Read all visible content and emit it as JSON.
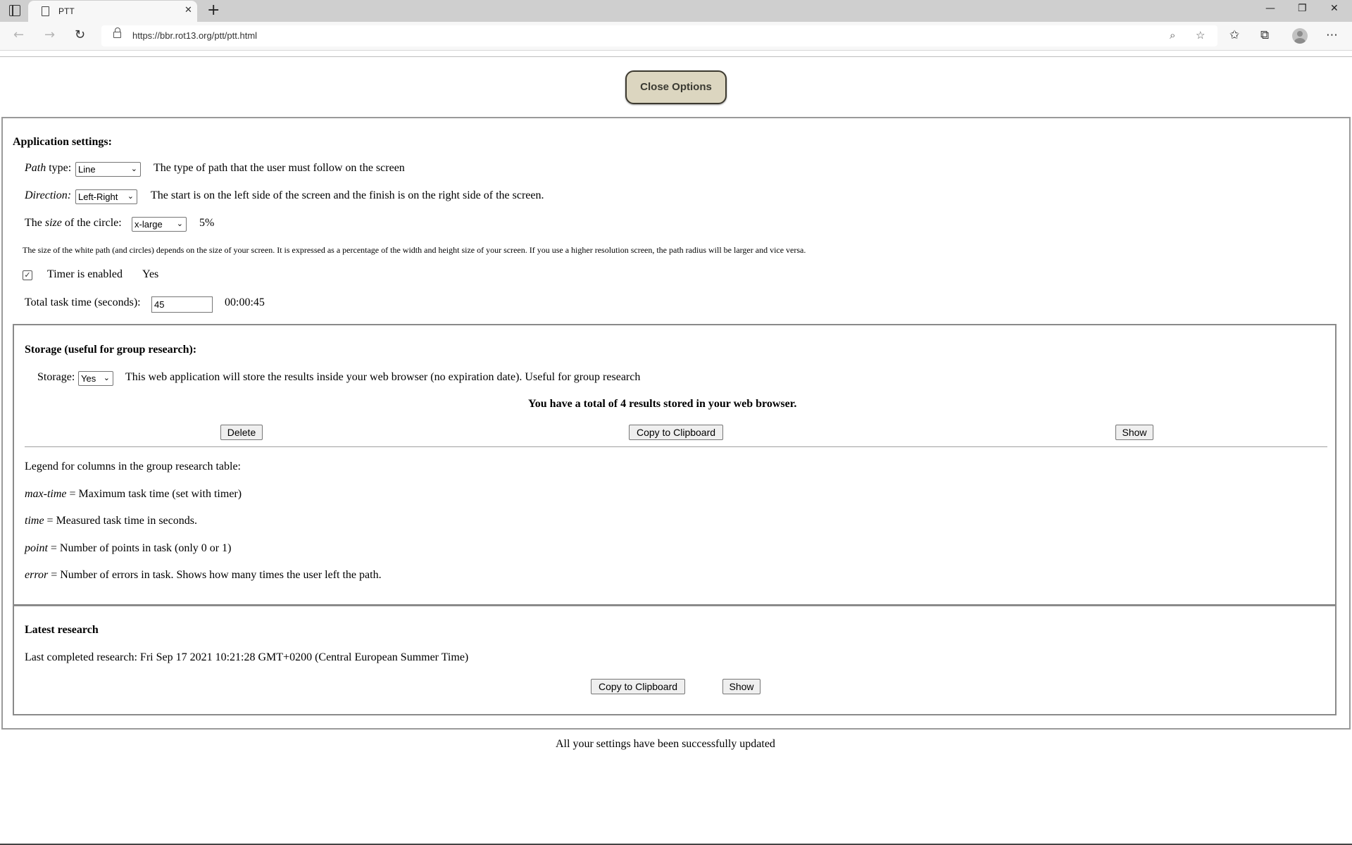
{
  "browser": {
    "tab_title": "PTT",
    "url": "https://bbr.rot13.org/ptt/ptt.html",
    "icons": [
      "sidebar-icon",
      "page-icon",
      "close-icon",
      "new-tab-icon",
      "back-icon",
      "forward-icon",
      "refresh-icon",
      "lock-icon",
      "zoom-icon",
      "add-favorite-icon",
      "favorites-icon",
      "collections-icon",
      "profile-icon",
      "more-icon",
      "minimize-icon",
      "restore-icon",
      "window-close-icon"
    ]
  },
  "close_options_label": "Close Options",
  "app_settings": {
    "heading": "Application settings:",
    "path_type": {
      "label_italic": "Path",
      "label_rest": " type:",
      "value": "Line",
      "description": "The type of path that the user must follow on the screen"
    },
    "direction": {
      "label": "Direction:",
      "value": "Left-Right",
      "description": "The start is on the left side of the screen and the finish is on the right side of the screen."
    },
    "size": {
      "label_before": "The ",
      "label_italic": "size",
      "label_after": " of the circle:",
      "value": "x-large",
      "percent": "5%"
    },
    "size_note": "The size of the white path (and circles) depends on the size of your screen. It is expressed as a percentage of the width and height size of your screen. If you use a higher resolution screen, the path radius will be larger and vice versa.",
    "timer": {
      "checked": true,
      "label": "Timer is enabled",
      "status": "Yes"
    },
    "total_time": {
      "label": "Total task time (seconds):",
      "value": "45",
      "formatted": "00:00:45"
    }
  },
  "storage": {
    "heading": "Storage (useful for group research):",
    "label": "Storage:",
    "value": "Yes",
    "description": "This web application will store the results inside your web browser (no expiration date). Useful for group research",
    "total_message": "You have a total of 4 results stored in your web browser.",
    "buttons": {
      "delete": "Delete",
      "copy": "Copy to Clipboard",
      "show": "Show"
    },
    "legend_title": "Legend for columns in the group research table:",
    "legend": [
      {
        "term": "max-time",
        "definition": " = Maximum task time (set with timer)"
      },
      {
        "term": "time",
        "definition": " = Measured task time in seconds."
      },
      {
        "term": "point",
        "definition": " = Number of points in task (only 0 or 1)"
      },
      {
        "term": "error",
        "definition": " = Number of errors in task. Shows how many times the user left the path."
      }
    ]
  },
  "latest": {
    "heading": "Latest research",
    "last_completed": "Last completed research: Fri Sep 17 2021 10:21:28 GMT+0200 (Central European Summer Time)",
    "buttons": {
      "copy": "Copy to Clipboard",
      "show": "Show"
    }
  },
  "status_message": "All your settings have been successfully updated"
}
